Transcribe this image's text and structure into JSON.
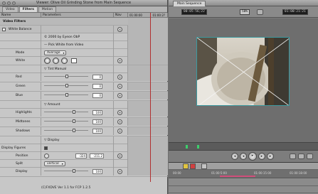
{
  "viewer": {
    "title": "Viewer: Olive Oil Grinding Stone from Main Sequence",
    "tabs": [
      "Video",
      "Filters",
      "Motion"
    ],
    "active_tab": "Filters",
    "columns": {
      "name": "Name",
      "parameters": "Parameters",
      "nav": "Nav",
      "time_start": "01:00:00",
      "time_end": "01:00:2?"
    },
    "rows": {
      "video_filters": "Video Filters",
      "white_balance": "White Balance",
      "copyright": "© 2000 by Eyeon ObP",
      "pick_white": "— Pick White from Video",
      "mode_label": "Mode",
      "mode_value": "Average",
      "white_label": "White",
      "tint_label": "▽ Tint Manual",
      "red_label": "Red",
      "red_value": "0",
      "green_label": "Green",
      "green_value": "0",
      "blue_label": "Blue",
      "blue_value": "0",
      "amount_label": "▽ Amount",
      "highlights_label": "Highlights",
      "highlights_value": "100",
      "midtones_label": "Midtones",
      "midtones_value": "100",
      "shadows_label": "Shadows",
      "shadows_value": "100",
      "display_section": "▽ Display",
      "display_figures_label": "Display Figures",
      "position_label": "Position",
      "position_x": "-324",
      "position_y": "-211.2",
      "split_label": "Split",
      "split_value": "vertical",
      "display_label": "Display",
      "display_value": "100"
    },
    "status": "(C)FXDVE Ver 1.1 for FCP 1.2.5"
  },
  "canvas": {
    "tab": "Main Sequence",
    "timecode_left": "00:05:56;22",
    "zoom": "50%",
    "timecode_right": "01:00:21:21",
    "ruler": [
      "00:00",
      "01:00:5:00",
      "01:00:15:00",
      "01:00:18:00"
    ],
    "accent": "#3d9aa0",
    "icons": [
      "rewind-icon",
      "play-icon",
      "fast-forward-icon",
      "mark-in-icon",
      "mark-out-icon"
    ]
  }
}
